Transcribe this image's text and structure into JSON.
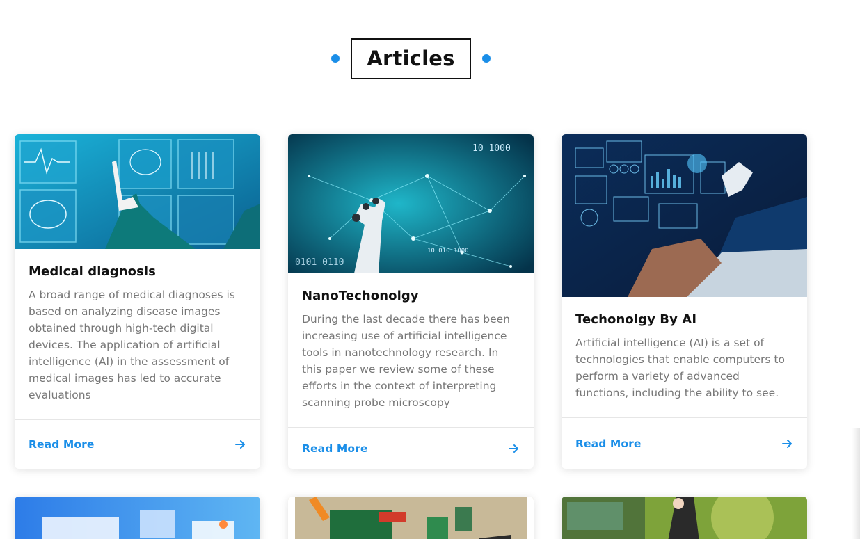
{
  "section": {
    "title": "Articles"
  },
  "articles": [
    {
      "title": "Medical diagnosis",
      "description": "A broad range of medical diagnoses is based on analyzing disease images obtained through high-tech digital devices. The application of artificial intelligence (AI) in the assessment of medical images has led to accurate evaluations",
      "read_more": "Read More",
      "image_icon": "medical-scan-image"
    },
    {
      "title": "NanoTechonolgy",
      "description": "During the last decade there has been increasing use of artificial intelligence tools in nanotechnology research. In this paper we review some of these efforts in the context of interpreting scanning probe microscopy",
      "read_more": "Read More",
      "image_icon": "robot-hand-network-image"
    },
    {
      "title": "Techonolgy By AI",
      "description": "Artificial intelligence (AI) is a set of technologies that enable computers to perform a variety of advanced functions, including the ability to see.",
      "read_more": "Read More",
      "image_icon": "laptop-ai-hologram-image"
    }
  ],
  "more_articles_images": [
    "isometric-web-image",
    "circuit-board-tools-image",
    "runner-park-image"
  ],
  "colors": {
    "accent": "#1a8ee8",
    "heading": "#111111",
    "body_text": "#777777"
  }
}
